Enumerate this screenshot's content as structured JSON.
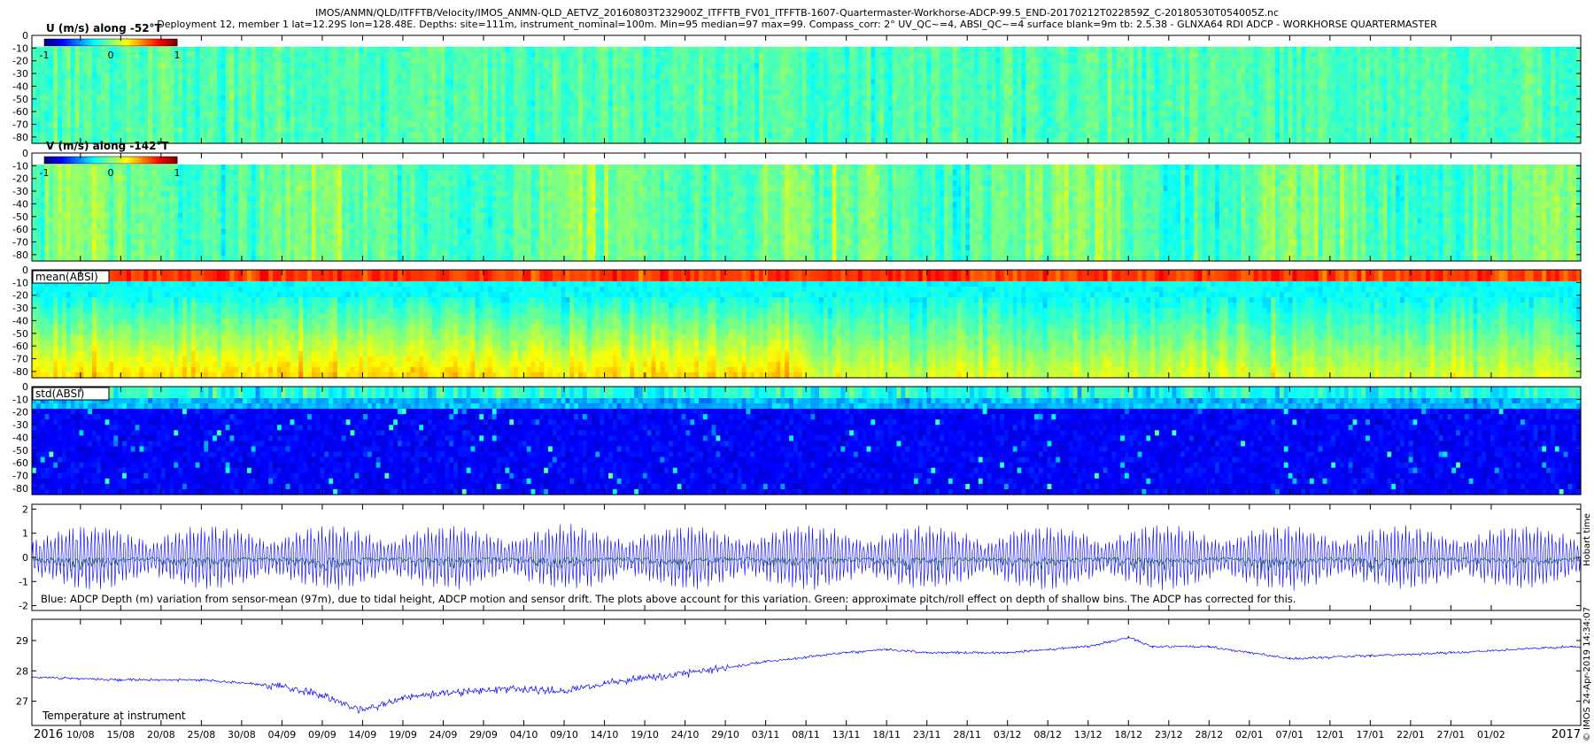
{
  "header": {
    "title_line1": "IMOS/ANMN/QLD/ITFFTB/Velocity/IMOS_ANMN-QLD_AETVZ_20160803T232900Z_ITFFTB_FV01_ITFFTB-1607-Quartermaster-Workhorse-ADCP-99.5_END-20170212T022859Z_C-20180530T054005Z.nc",
    "title_line2": "Deployment 12, member 1 lat=12.29S lon=128.48E. Depths: site=111m, instrument_nominal=100m. Min=95 median=97 max=99. Compass_corr: 2° UV_QC~=4, ABSI_QC~=4 surface blank=9m tb: 2.5.38 - GLNXA64 RDI ADCP - WORKHORSE QUARTERMASTER"
  },
  "side_labels": {
    "hobart_time": "Hobart time",
    "imos_stamp": "© IMOS 24-Apr-2019 14:34:07"
  },
  "colors": {
    "depth_line": "#0000ff",
    "pitch_roll_line": "#006400",
    "temperature_line": "#0000ff"
  },
  "chart_data": [
    {
      "type": "heatmap",
      "title": "U (m/s) along -52°T",
      "colorbar": {
        "ticks": [
          "-1",
          "0",
          "1"
        ],
        "range": [
          -1,
          1
        ]
      },
      "y_ticks": [
        "0",
        "-10",
        "-20",
        "-30",
        "-40",
        "-50",
        "-60",
        "-70",
        "-80"
      ],
      "ylim": [
        -85,
        0
      ],
      "surface_blank_m": 9,
      "colormap": "jet"
    },
    {
      "type": "heatmap",
      "title": "V (m/s) along -142°T",
      "colorbar": {
        "ticks": [
          "-1",
          "0",
          "1"
        ],
        "range": [
          -1,
          1
        ]
      },
      "y_ticks": [
        "0",
        "-10",
        "-20",
        "-30",
        "-40",
        "-50",
        "-60",
        "-70",
        "-80"
      ],
      "ylim": [
        -85,
        0
      ],
      "colormap": "jet"
    },
    {
      "type": "heatmap",
      "title": "mean(ABSI)",
      "y_ticks": [
        "0",
        "-10",
        "-20",
        "-30",
        "-40",
        "-50",
        "-60",
        "-70",
        "-80"
      ],
      "ylim": [
        -85,
        0
      ],
      "colormap": "jet"
    },
    {
      "type": "heatmap",
      "title": "std(ABSI)",
      "y_ticks": [
        "0",
        "-10",
        "-20",
        "-30",
        "-40",
        "-50",
        "-60",
        "-70",
        "-80"
      ],
      "ylim": [
        -85,
        0
      ],
      "colormap": "jet"
    },
    {
      "type": "line",
      "annotation": "Blue: ADCP Depth (m) variation from sensor-mean (97m), due to tidal height, ADCP motion and sensor drift. The plots above account for this variation. Green: approximate pitch/roll effect on depth of shallow bins. The ADCP has corrected for this.",
      "y_ticks": [
        "2",
        "1",
        "0",
        "-1",
        "-2"
      ],
      "ylim": [
        -2.2,
        2.2
      ]
    },
    {
      "type": "line",
      "annotation": "Temperature at instrument",
      "y_ticks": [
        "29",
        "28",
        "27"
      ],
      "ylim": [
        26.2,
        29.7
      ],
      "series": [
        {
          "x": [
            "2016-08-04",
            "2016-08-15",
            "2016-08-25",
            "2016-09-04",
            "2016-09-09",
            "2016-09-14",
            "2016-09-19",
            "2016-09-24",
            "2016-10-04",
            "2016-10-09",
            "2016-10-14",
            "2016-10-24",
            "2016-11-03",
            "2016-11-13",
            "2016-11-18",
            "2016-11-23",
            "2016-12-03",
            "2016-12-13",
            "2016-12-18",
            "2016-12-21",
            "2016-12-28",
            "2017-01-02",
            "2017-01-07",
            "2017-01-17",
            "2017-01-27",
            "2017-02-11"
          ],
          "y": [
            27.8,
            27.7,
            27.7,
            27.5,
            27.2,
            26.7,
            27.1,
            27.3,
            27.4,
            27.3,
            27.6,
            27.9,
            28.3,
            28.6,
            28.7,
            28.6,
            28.6,
            28.8,
            29.1,
            28.8,
            28.8,
            28.6,
            28.4,
            28.5,
            28.6,
            28.8
          ]
        }
      ]
    }
  ],
  "time_axis": {
    "start_year_label": "2016",
    "end_year_label": "2017",
    "tick_labels": [
      "10/08",
      "15/08",
      "20/08",
      "25/08",
      "30/08",
      "04/09",
      "09/09",
      "14/09",
      "19/09",
      "24/09",
      "29/09",
      "04/10",
      "09/10",
      "14/10",
      "19/10",
      "24/10",
      "29/10",
      "03/11",
      "08/11",
      "13/11",
      "18/11",
      "23/11",
      "28/11",
      "03/12",
      "08/12",
      "13/12",
      "18/12",
      "23/12",
      "28/12",
      "02/01",
      "07/01",
      "12/01",
      "17/01",
      "22/01",
      "27/01",
      "01/02"
    ]
  }
}
